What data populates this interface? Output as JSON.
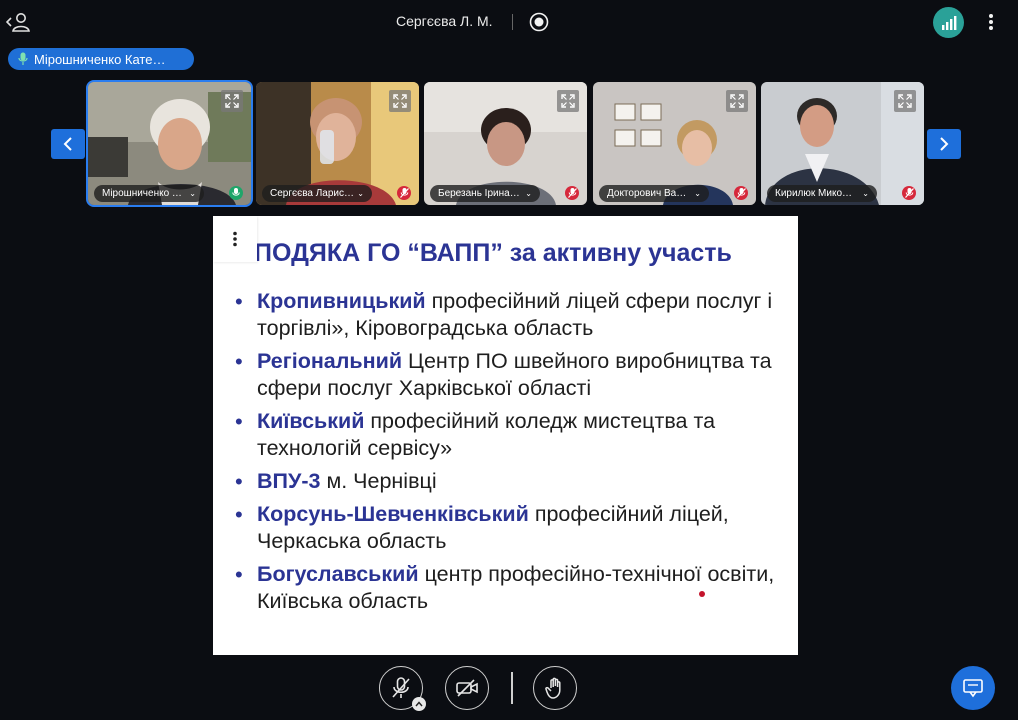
{
  "header": {
    "presenter_name": "Сергєєва Л. М.",
    "icons": [
      "user-back-icon",
      "record-icon",
      "signal-icon",
      "more-vert-icon"
    ],
    "signal_color": "#2aa198"
  },
  "speaker_indicator": {
    "label": "Мірошниченко Кате…",
    "color": "#1f6fd6"
  },
  "participants": [
    {
      "name": "Мірошниченко …",
      "mic": "on"
    },
    {
      "name": "Сергєєва Ларис…",
      "mic": "off"
    },
    {
      "name": "Березань Ірина…",
      "mic": "off"
    },
    {
      "name": "Докторович Ва…",
      "mic": "off"
    },
    {
      "name": "Кирилюк Мико…",
      "mic": "off"
    }
  ],
  "slide": {
    "title": "ПОДЯКА ГО “ВАПП” за активну участь",
    "items": [
      {
        "bold": "Кропивницький",
        "rest": " професійний ліцей сфери послуг і торгівлі», Кіровоградська область"
      },
      {
        "bold": "Регіональний",
        "rest": " Центр ПО швейного виробництва та сфери послуг Харківської області"
      },
      {
        "bold": "Київський",
        "rest": " професійний коледж мистецтва та технологій сервісу»"
      },
      {
        "bold": "ВПУ-3",
        "rest": " м. Чернівці"
      },
      {
        "bold": "Корсунь-Шевченківський",
        "rest": " професійний ліцей, Черкаська область"
      },
      {
        "bold": "Богуславський",
        "rest": " центр професійно-технічної освіти, Київська область"
      }
    ],
    "accent_color": "#2b3494"
  },
  "controls": {
    "icons": [
      "mic-off-icon",
      "camera-off-icon",
      "raise-hand-icon",
      "chat-icon"
    ],
    "accent_color": "#1e6fdb"
  }
}
